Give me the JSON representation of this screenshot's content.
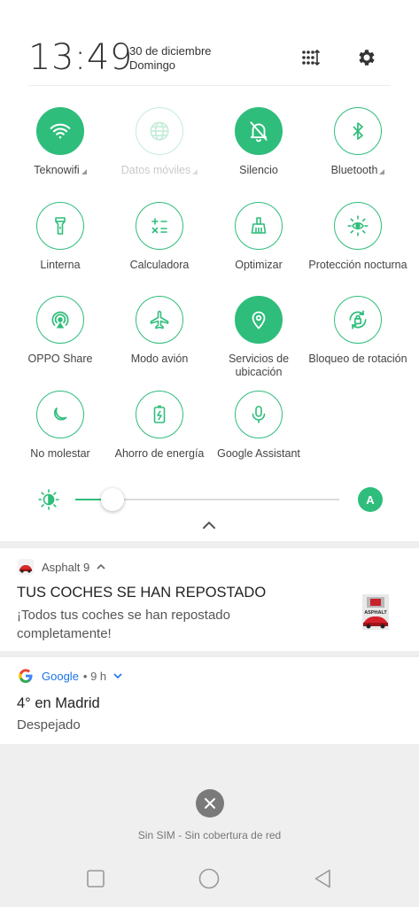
{
  "header": {
    "time": "13:49",
    "date_line1": "30 de diciembre",
    "date_line2": "Domingo"
  },
  "tiles": [
    {
      "label": "Teknowifi",
      "icon": "wifi-icon",
      "state": "on",
      "has_more": true
    },
    {
      "label": "Datos móviles",
      "icon": "globe-icon",
      "state": "disabled",
      "has_more": true
    },
    {
      "label": "Silencio",
      "icon": "bell-off-icon",
      "state": "on",
      "has_more": false
    },
    {
      "label": "Bluetooth",
      "icon": "bluetooth-icon",
      "state": "off",
      "has_more": true
    },
    {
      "label": "Linterna",
      "icon": "flashlight-icon",
      "state": "off"
    },
    {
      "label": "Calculadora",
      "icon": "calculator-icon",
      "state": "off"
    },
    {
      "label": "Optimizar",
      "icon": "broom-icon",
      "state": "off"
    },
    {
      "label": "Protección nocturna",
      "icon": "eye-sun-icon",
      "state": "off"
    },
    {
      "label": "OPPO Share",
      "icon": "share-icon",
      "state": "off"
    },
    {
      "label": "Modo avión",
      "icon": "airplane-icon",
      "state": "off"
    },
    {
      "label": "Servicios de ubicación",
      "icon": "location-pin-icon",
      "state": "on"
    },
    {
      "label": "Bloqueo de rotación",
      "icon": "rotation-lock-icon",
      "state": "off"
    },
    {
      "label": "No molestar",
      "icon": "moon-icon",
      "state": "off"
    },
    {
      "label": "Ahorro de energía",
      "icon": "battery-saver-icon",
      "state": "off"
    },
    {
      "label": "Google Assistant",
      "icon": "microphone-icon",
      "state": "off"
    }
  ],
  "brightness": {
    "level": 0.14,
    "auto_label": "A"
  },
  "notifications": [
    {
      "app": "Asphalt 9",
      "title": "TUS COCHES SE HAN REPOSTADO",
      "body": "¡Todos tus coches se han repostado completamente!",
      "thumbnail_text": "ASPHALT"
    },
    {
      "app": "Google",
      "meta": "• 9 h",
      "title": "4° en Madrid",
      "body": "Despejado"
    }
  ],
  "status": {
    "no_sim": "Sin SIM - Sin cobertura de red"
  },
  "colors": {
    "accent": "#2fbd7b",
    "google_blue": "#1a73e8"
  }
}
